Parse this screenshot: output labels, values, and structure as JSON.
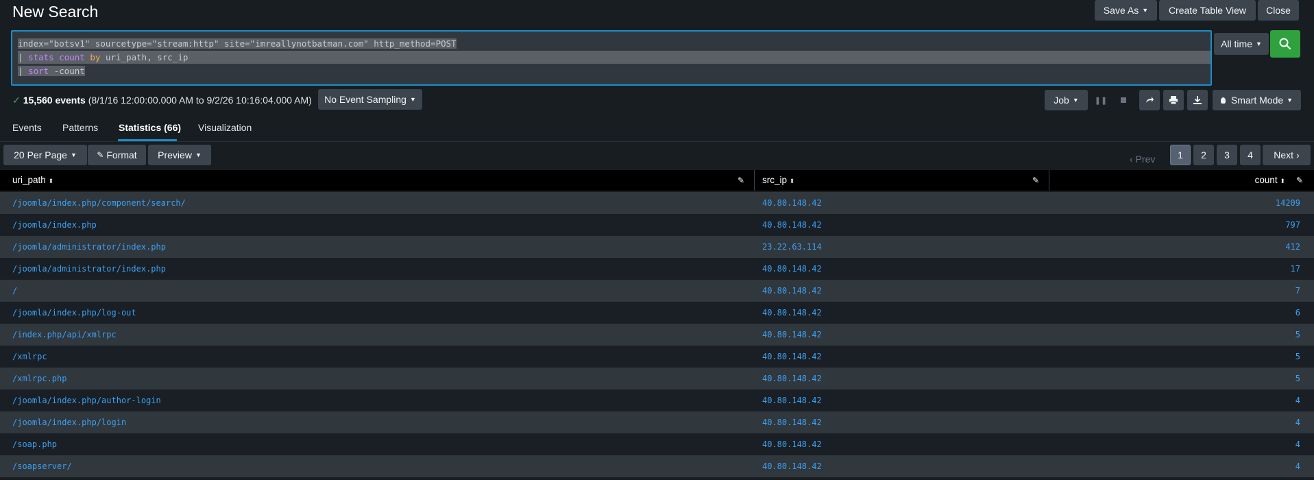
{
  "header": {
    "title": "New Search",
    "save_as": "Save As",
    "create_table_view": "Create Table View",
    "close": "Close"
  },
  "search": {
    "query_lines": [
      "index=\"botsv1\" sourcetype=\"stream:http\" site=\"imreallynotbatman.com\" http_method=POST",
      {
        "pipe": "| ",
        "cmd": "stats",
        "fn": "count",
        "by": "by",
        "args": " uri_path, src_ip"
      },
      {
        "pipe": "| ",
        "cmd": "sort",
        "args": " -count"
      }
    ],
    "time_range": "All time",
    "submit_icon": "magnifier-icon"
  },
  "results_meta": {
    "count": "15,560 events",
    "range": "(8/1/16 12:00:00.000 AM to 9/2/26 10:16:04.000 AM)",
    "sampling": "No Event Sampling",
    "job": "Job",
    "mode": "Smart Mode",
    "icons": [
      "pause-icon",
      "stop-icon",
      "share-icon",
      "print-icon",
      "download-icon",
      "lightbulb-icon"
    ]
  },
  "tabs": [
    {
      "label": "Events"
    },
    {
      "label": "Patterns"
    },
    {
      "label": "Statistics (66)",
      "active": true
    },
    {
      "label": "Visualization"
    }
  ],
  "toolbar": {
    "per_page": "20 Per Page",
    "format": "Format",
    "preview": "Preview",
    "prev": "Prev",
    "next": "Next",
    "pages": [
      "1",
      "2",
      "3",
      "4"
    ],
    "current_page": "1"
  },
  "table": {
    "columns": [
      "uri_path",
      "src_ip",
      "count"
    ],
    "rows": [
      [
        "/joomla/index.php/component/search/",
        "40.80.148.42",
        "14209"
      ],
      [
        "/joomla/index.php",
        "40.80.148.42",
        "797"
      ],
      [
        "/joomla/administrator/index.php",
        "23.22.63.114",
        "412"
      ],
      [
        "/joomla/administrator/index.php",
        "40.80.148.42",
        "17"
      ],
      [
        "/",
        "40.80.148.42",
        "7"
      ],
      [
        "/joomla/index.php/log-out",
        "40.80.148.42",
        "6"
      ],
      [
        "/index.php/api/xmlrpc",
        "40.80.148.42",
        "5"
      ],
      [
        "/xmlrpc",
        "40.80.148.42",
        "5"
      ],
      [
        "/xmlrpc.php",
        "40.80.148.42",
        "5"
      ],
      [
        "/joomla/index.php/author-login",
        "40.80.148.42",
        "4"
      ],
      [
        "/joomla/index.php/login",
        "40.80.148.42",
        "4"
      ],
      [
        "/soap.php",
        "40.80.148.42",
        "4"
      ],
      [
        "/soapserver/",
        "40.80.148.42",
        "4"
      ]
    ]
  },
  "colors": {
    "background": "#171d21",
    "link": "#3da1f5",
    "accent": "#1a8fc9",
    "search_button": "#2fa13e",
    "success": "#53a051"
  }
}
